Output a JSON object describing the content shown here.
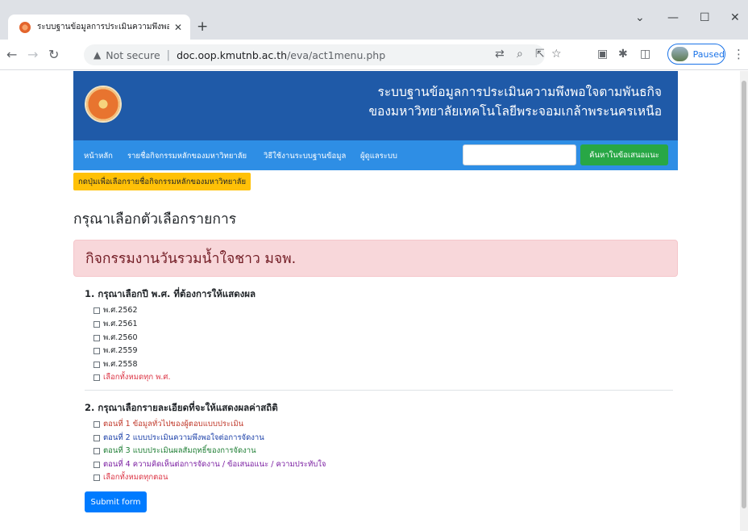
{
  "browser": {
    "tab_title": "ระบบฐานข้อมูลการประเมินความพึงพอใ",
    "security_label": "Not secure",
    "url_host": "doc.oop.kmutnb.ac.th",
    "url_path": "/eva/act1menu.php",
    "profile_status": "Paused"
  },
  "banner": {
    "title_line1": "ระบบฐานข้อมูลการประเมินความพึงพอใจตามพันธกิจ",
    "title_line2": "ของมหาวิทยาลัยเทคโนโลยีพระจอมเกล้าพระนครเหนือ"
  },
  "nav": {
    "items": [
      "หน้าหลัก",
      "รายชื่อกิจกรรมหลักของมหาวิทยาลัย",
      "วิธีใช้งานระบบฐานข้อมูล",
      "ผู้ดูแลระบบ"
    ],
    "search_value": "",
    "search_button": "ค้นหาในข้อเสนอแนะ"
  },
  "hint_button": "กดปุ่มเพื่อเลือกรายชื่อกิจกรรมหลักของมหาวิทยาลัย",
  "heading": "กรุณาเลือกตัวเลือกรายการ",
  "activity_title": "กิจกรรมงานวันรวมน้ำใจชาว มจพ.",
  "section1": {
    "title": "1. กรุณาเลือกปี พ.ศ. ที่ต้องการให้แสดงผล",
    "options": [
      {
        "label": "พ.ศ.2562",
        "color": "#212529"
      },
      {
        "label": "พ.ศ.2561",
        "color": "#212529"
      },
      {
        "label": "พ.ศ.2560",
        "color": "#212529"
      },
      {
        "label": "พ.ศ.2559",
        "color": "#212529"
      },
      {
        "label": "พ.ศ.2558",
        "color": "#212529"
      },
      {
        "label": "เลือกทั้งหมดทุก พ.ศ.",
        "color": "#dc3545"
      }
    ]
  },
  "section2": {
    "title": "2. กรุณาเลือกรายละเอียดที่จะให้แสดงผลค่าสถิติ",
    "options": [
      {
        "label": "ตอนที่ 1 ข้อมูลทั่วไปของผู้ตอบแบบประเมิน",
        "color": "#c0392b"
      },
      {
        "label": "ตอนที่ 2 แบบประเมินความพึงพอใจต่อการจัดงาน",
        "color": "#1a3fa8"
      },
      {
        "label": "ตอนที่ 3 แบบประเมินผลสัมฤทธิ์ของการจัดงาน",
        "color": "#1e7e34"
      },
      {
        "label": "ตอนที่ 4 ความคิดเห็นต่อการจัดงาน / ข้อเสนอแนะ / ความประทับใจ",
        "color": "#7b1fa2"
      },
      {
        "label": "เลือกทั้งหมดทุกตอน",
        "color": "#dc3545"
      }
    ]
  },
  "submit_label": "Submit form"
}
